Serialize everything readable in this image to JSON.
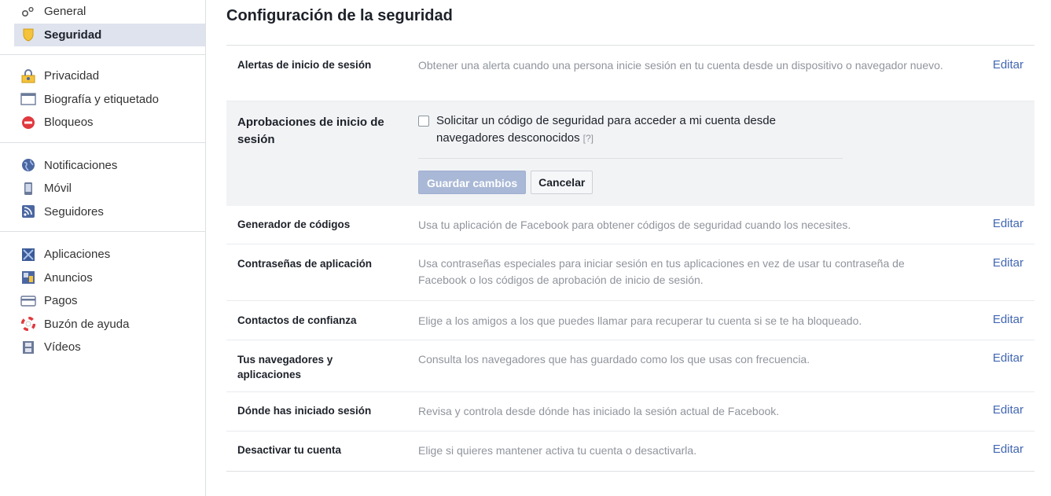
{
  "sidebar": {
    "groups": [
      {
        "items": [
          {
            "label": "General",
            "icon": "gears-icon"
          },
          {
            "label": "Seguridad",
            "icon": "shield-icon",
            "selected": true
          }
        ]
      },
      {
        "items": [
          {
            "label": "Privacidad",
            "icon": "lock-people-icon"
          },
          {
            "label": "Biografía y etiquetado",
            "icon": "window-icon"
          },
          {
            "label": "Bloqueos",
            "icon": "block-icon"
          }
        ]
      },
      {
        "items": [
          {
            "label": "Notificaciones",
            "icon": "globe-icon"
          },
          {
            "label": "Móvil",
            "icon": "mobile-icon"
          },
          {
            "label": "Seguidores",
            "icon": "rss-icon"
          }
        ]
      },
      {
        "items": [
          {
            "label": "Aplicaciones",
            "icon": "apps-icon"
          },
          {
            "label": "Anuncios",
            "icon": "ads-icon"
          },
          {
            "label": "Pagos",
            "icon": "card-icon"
          },
          {
            "label": "Buzón de ayuda",
            "icon": "lifebuoy-icon"
          },
          {
            "label": "Vídeos",
            "icon": "film-icon"
          }
        ]
      }
    ]
  },
  "main": {
    "title": "Configuración de la seguridad",
    "edit_label": "Editar",
    "rows": [
      {
        "label": "Alertas de inicio de sesión",
        "desc": "Obtener una alerta cuando una persona inicie sesión en tu cuenta desde un dispositivo o navegador nuevo."
      },
      {
        "label": "Generador de códigos",
        "desc": "Usa tu aplicación de Facebook para obtener códigos de seguridad cuando los necesites."
      },
      {
        "label": "Contraseñas de aplicación",
        "desc": "Usa contraseñas especiales para iniciar sesión en tus aplicaciones en vez de usar tu contraseña de Facebook o los códigos de aprobación de inicio de sesión."
      },
      {
        "label": "Contactos de confianza",
        "desc": "Elige a los amigos a los que puedes llamar para recuperar tu cuenta si se te ha bloqueado."
      },
      {
        "label": "Tus navegadores y aplicaciones",
        "desc": "Consulta los navegadores que has guardado como los que usas con frecuencia."
      },
      {
        "label": "Dónde has iniciado sesión",
        "desc": "Revisa y controla desde dónde has iniciado la sesión actual de Facebook."
      },
      {
        "label": "Desactivar tu cuenta",
        "desc": "Elige si quieres mantener activa tu cuenta o desactivarla."
      }
    ],
    "expanded": {
      "label": "Aprobaciones de inicio de sesión",
      "checkbox_text": "Solicitar un código de seguridad para acceder a mi cuenta desde navegadores desconocidos",
      "help": "[?]",
      "checked": false,
      "save_label": "Guardar cambios",
      "cancel_label": "Cancelar"
    }
  },
  "colors": {
    "link": "#4267b2",
    "selected_bg": "#dfe3ee",
    "save_disabled": "#a9b8d6"
  }
}
